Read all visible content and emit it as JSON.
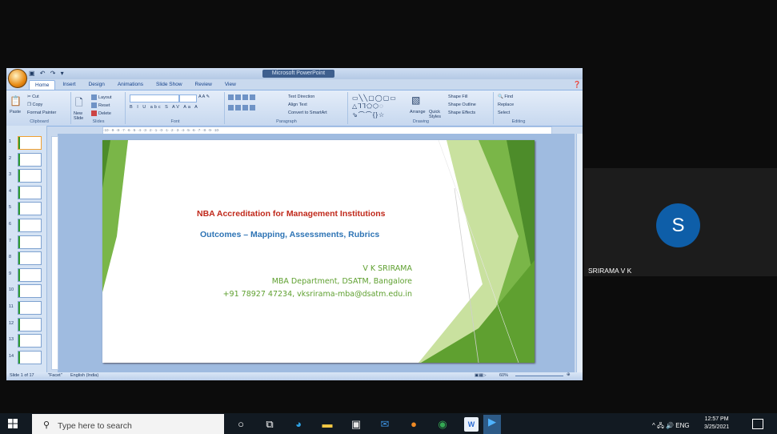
{
  "app": {
    "window_title": "Microsoft PowerPoint",
    "quick_access": "▣ ↶ ↷ ▾",
    "tabs": [
      "Home",
      "Insert",
      "Design",
      "Animations",
      "Slide Show",
      "Review",
      "View"
    ]
  },
  "ribbon": {
    "clipboard": {
      "paste": "Paste",
      "cut": "Cut",
      "copy": "Copy",
      "format_painter": "Format Painter",
      "label": "Clipboard"
    },
    "slides": {
      "new_slide": "New Slide",
      "layout": "Layout",
      "reset": "Reset",
      "delete": "Delete",
      "label": "Slides"
    },
    "font": {
      "label": "Font",
      "tools": "B I U abc S AV Aa A"
    },
    "paragraph": {
      "label": "Paragraph",
      "text_direction": "Text Direction",
      "align_text": "Align Text",
      "convert_smartart": "Convert to SmartArt"
    },
    "drawing": {
      "label": "Drawing",
      "arrange": "Arrange",
      "quick_styles": "Quick Styles",
      "shape_fill": "Shape Fill",
      "shape_outline": "Shape Outline",
      "shape_effects": "Shape Effects"
    },
    "editing": {
      "label": "Editing",
      "find": "Find",
      "replace": "Replace",
      "select": "Select"
    }
  },
  "ruler": "·10· ·9· ·8· ·7· ·6· ·5· ·4· ·3· ·2· ·1· ·0· ·1· ·2· ·3· ·4· ·5· ·6· ·7· ·8· ·9· ·10·",
  "thumbnails": [
    "1",
    "2",
    "3",
    "4",
    "5",
    "6",
    "7",
    "8",
    "9",
    "10",
    "11",
    "12",
    "13",
    "14"
  ],
  "slide": {
    "title": "NBA Accreditation for Management Institutions",
    "subtitle": "Outcomes – Mapping, Assessments, Rubrics",
    "author": "V K SRIRAMA",
    "dept": "MBA Department, DSATM, Bangalore",
    "contact": "+91 78927 47234, vksrirama-mba@dsatm.edu.in",
    "title_color": "#c0291b",
    "subtitle_color": "#2e74b5",
    "author_color": "#5fa030",
    "accent_green": "#7ab648"
  },
  "status": {
    "slide_info": "Slide 1 of 17",
    "theme": "\"Facet\"",
    "language": "English (India)",
    "zoom": "60%"
  },
  "participant": {
    "initial": "S",
    "name": "SRIRAMA V K",
    "avatar_color": "#0e5ea8"
  },
  "taskbar": {
    "search_placeholder": "Type here to search",
    "tray": "^ 🖧 🔊 ENG",
    "time": "12:57 PM",
    "date": "3/25/2021"
  }
}
